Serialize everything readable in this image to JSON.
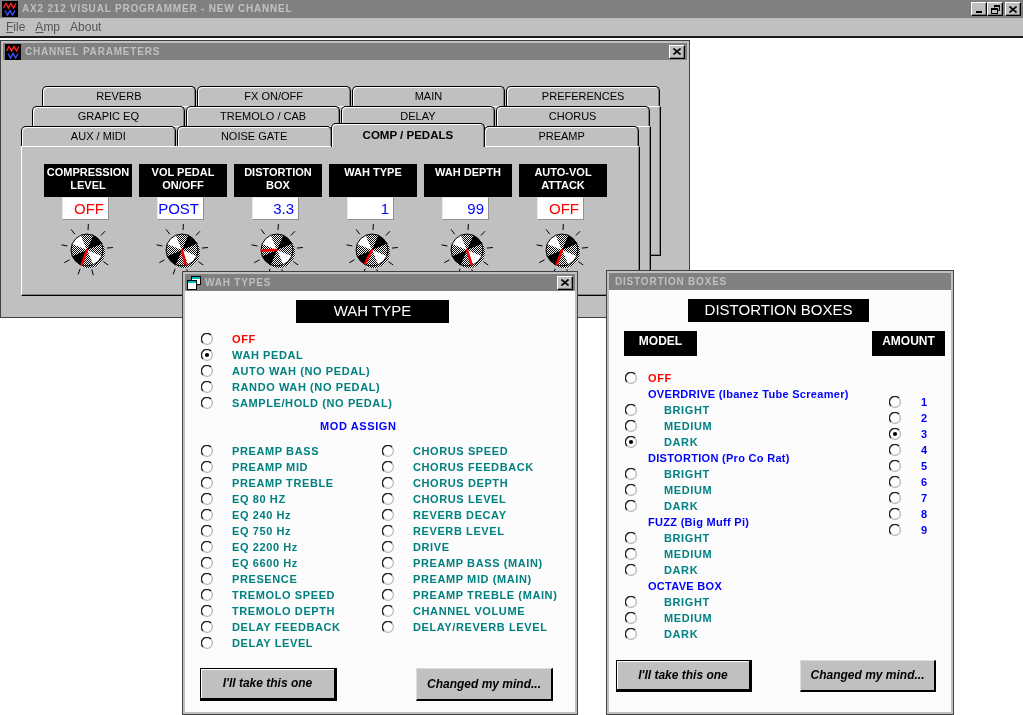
{
  "window": {
    "title": "AX2 212 VISUAL PROGRAMMER - NEW CHANNEL"
  },
  "menu": [
    {
      "label": "File",
      "mnemonic": true
    },
    {
      "label": "Amp",
      "mnemonic": true
    },
    {
      "label": "About",
      "mnemonic": false
    }
  ],
  "channel_parameters": {
    "title": "CHANNEL PARAMETERS",
    "tab_rows": [
      {
        "tabs": [
          {
            "label": "REVERB",
            "selected": false
          },
          {
            "label": "FX ON/OFF",
            "selected": false
          },
          {
            "label": "MAIN",
            "selected": false
          },
          {
            "label": "PREFERENCES",
            "selected": false
          }
        ]
      },
      {
        "tabs": [
          {
            "label": "GRAPIC EQ",
            "selected": false
          },
          {
            "label": "TREMOLO / CAB",
            "selected": false
          },
          {
            "label": "DELAY",
            "selected": false
          },
          {
            "label": "CHORUS",
            "selected": false
          }
        ]
      },
      {
        "tabs": [
          {
            "label": "AUX / MIDI",
            "selected": false
          },
          {
            "label": "NOISE GATE",
            "selected": false
          },
          {
            "label": "COMP / PEDALS",
            "selected": true
          },
          {
            "label": "PREAMP",
            "selected": false
          }
        ]
      }
    ],
    "controls": [
      {
        "label": "COMPRESSION\nLEVEL",
        "value": "OFF",
        "color": "#ff0000",
        "level": 0
      },
      {
        "label": "VOL PEDAL\nON/OFF",
        "value": "POST",
        "color": "#0000ff",
        "level": 1
      },
      {
        "label": "DISTORTION\nBOX",
        "value": "3.3",
        "color": "#0000ff",
        "level": 0.21
      },
      {
        "label": "WAH TYPE",
        "value": "1",
        "color": "#0000ff",
        "level": 0.02
      },
      {
        "label": "WAH DEPTH",
        "value": "99",
        "color": "#0000ff",
        "level": 0.99
      },
      {
        "label": "AUTO-VOL\nATTACK",
        "value": "OFF",
        "color": "#ff0000",
        "level": 0
      }
    ]
  },
  "wah_types": {
    "title": "WAH TYPES",
    "heading": "WAH TYPE",
    "options": [
      {
        "label": "OFF",
        "color": "#ff0000",
        "selected": false
      },
      {
        "label": "WAH PEDAL",
        "color": "#008080",
        "selected": true
      },
      {
        "label": "AUTO WAH (NO PEDAL)",
        "color": "#008080",
        "selected": false
      },
      {
        "label": "RANDO WAH (NO PEDAL)",
        "color": "#008080",
        "selected": false
      },
      {
        "label": "SAMPLE/HOLD (NO PEDAL)",
        "color": "#008080",
        "selected": false
      }
    ],
    "mod_assign": {
      "heading": "MOD ASSIGN",
      "columns": [
        {
          "options": [
            {
              "label": "PREAMP BASS",
              "selected": false
            },
            {
              "label": "PREAMP MID",
              "selected": false
            },
            {
              "label": "PREAMP TREBLE",
              "selected": false
            },
            {
              "label": "EQ 80 HZ",
              "selected": false
            },
            {
              "label": "EQ 240 Hz",
              "selected": false
            },
            {
              "label": "EQ 750 Hz",
              "selected": false
            },
            {
              "label": "EQ 2200 Hz",
              "selected": false
            },
            {
              "label": "EQ 6600 Hz",
              "selected": false
            },
            {
              "label": "PRESENCE",
              "selected": false
            },
            {
              "label": "TREMOLO SPEED",
              "selected": false
            },
            {
              "label": "TREMOLO DEPTH",
              "selected": false
            },
            {
              "label": "DELAY FEEDBACK",
              "selected": false
            },
            {
              "label": "DELAY LEVEL",
              "selected": false
            }
          ]
        },
        {
          "options": [
            {
              "label": "CHORUS SPEED",
              "selected": false
            },
            {
              "label": "CHORUS FEEDBACK",
              "selected": false
            },
            {
              "label": "CHORUS DEPTH",
              "selected": false
            },
            {
              "label": "CHORUS LEVEL",
              "selected": false
            },
            {
              "label": "REVERB DECAY",
              "selected": false
            },
            {
              "label": "REVERB LEVEL",
              "selected": false
            },
            {
              "label": "DRIVE",
              "selected": false
            },
            {
              "label": "PREAMP BASS (MAIN)",
              "selected": false
            },
            {
              "label": "PREAMP MID (MAIN)",
              "selected": false
            },
            {
              "label": "PREAMP TREBLE (MAIN)",
              "selected": false
            },
            {
              "label": "CHANNEL VOLUME",
              "selected": false
            },
            {
              "label": "DELAY/REVERB LEVEL",
              "selected": false
            }
          ]
        }
      ]
    },
    "buttons": [
      {
        "label": "I'll take this one",
        "default": true
      },
      {
        "label": "Changed my mind...",
        "default": false
      }
    ]
  },
  "distortion_boxes": {
    "title": "DISTORTION BOXES",
    "heading": "DISTORTION BOXES",
    "model": {
      "heading": "MODEL",
      "items": [
        {
          "kind": "option",
          "label": "OFF",
          "color": "#ff0000",
          "selected": false
        },
        {
          "kind": "group",
          "label": "OVERDRIVE (Ibanez Tube Screamer)",
          "children": [
            {
              "kind": "option",
              "label": "BRIGHT",
              "color": "#008080",
              "selected": false
            },
            {
              "kind": "option",
              "label": "MEDIUM",
              "color": "#008080",
              "selected": false
            },
            {
              "kind": "option",
              "label": "DARK",
              "color": "#008080",
              "selected": true
            }
          ]
        },
        {
          "kind": "group",
          "label": "DISTORTION (Pro Co Rat)",
          "children": [
            {
              "kind": "option",
              "label": "BRIGHT",
              "color": "#008080",
              "selected": false
            },
            {
              "kind": "option",
              "label": "MEDIUM",
              "color": "#008080",
              "selected": false
            },
            {
              "kind": "option",
              "label": "DARK",
              "color": "#008080",
              "selected": false
            }
          ]
        },
        {
          "kind": "group",
          "label": "FUZZ (Big Muff Pi)",
          "children": [
            {
              "kind": "option",
              "label": "BRIGHT",
              "color": "#008080",
              "selected": false
            },
            {
              "kind": "option",
              "label": "MEDIUM",
              "color": "#008080",
              "selected": false
            },
            {
              "kind": "option",
              "label": "DARK",
              "color": "#008080",
              "selected": false
            }
          ]
        },
        {
          "kind": "group",
          "label": "OCTAVE BOX",
          "children": [
            {
              "kind": "option",
              "label": "BRIGHT",
              "color": "#008080",
              "selected": false
            },
            {
              "kind": "option",
              "label": "MEDIUM",
              "color": "#008080",
              "selected": false
            },
            {
              "kind": "option",
              "label": "DARK",
              "color": "#008080",
              "selected": false
            }
          ]
        }
      ]
    },
    "amount": {
      "heading": "AMOUNT",
      "items": [
        {
          "label": "1",
          "selected": false
        },
        {
          "label": "2",
          "selected": false
        },
        {
          "label": "3",
          "selected": true
        },
        {
          "label": "4",
          "selected": false
        },
        {
          "label": "5",
          "selected": false
        },
        {
          "label": "6",
          "selected": false
        },
        {
          "label": "7",
          "selected": false
        },
        {
          "label": "8",
          "selected": false
        },
        {
          "label": "9",
          "selected": false
        }
      ]
    },
    "buttons": [
      {
        "label": "I'll take this one",
        "default": true
      },
      {
        "label": "Changed my mind...",
        "default": false
      }
    ]
  }
}
